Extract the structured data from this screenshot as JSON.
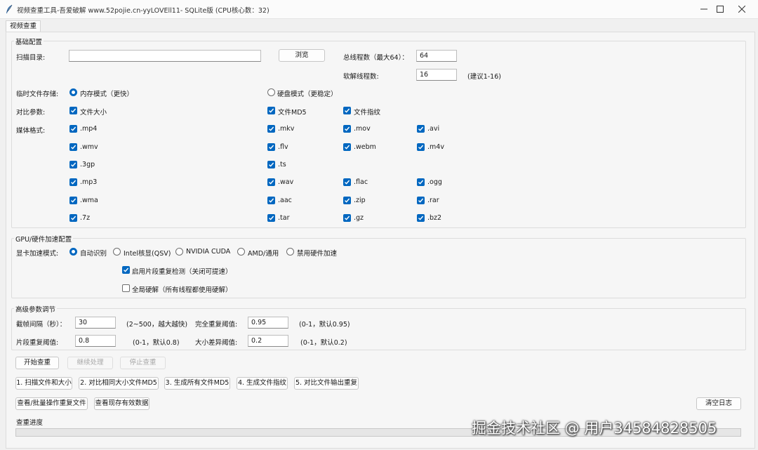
{
  "window": {
    "title": "视频查重工具-吾爱破解 www.52pojie.cn-yyLOVEll11- SQLite版 (CPU核心数：32)"
  },
  "tab": {
    "label": "视频查重"
  },
  "basic": {
    "group_title": "基础配置",
    "scan_dir_label": "扫描目录:",
    "scan_dir_value": "",
    "browse_label": "浏览",
    "total_threads_label": "总线程数（最大64）：",
    "total_threads_value": "64",
    "soft_threads_label": "软解线程数:",
    "soft_threads_value": "16",
    "soft_threads_hint": "(建议1-16)",
    "temp_storage_label": "临时文件存储:",
    "temp_mode_memory": "内存模式（更快）",
    "temp_mode_disk": "硬盘模式（更稳定）",
    "compare_label": "对比参数:",
    "compare_size": "文件大小",
    "compare_md5": "文件MD5",
    "compare_fingerprint": "文件指纹",
    "media_label": "媒体格式:",
    "formats": [
      ".mp4",
      ".mkv",
      ".mov",
      ".avi",
      ".wmv",
      ".flv",
      ".webm",
      ".m4v",
      ".3gp",
      ".ts",
      ".mp3",
      ".wav",
      ".flac",
      ".ogg",
      ".wma",
      ".aac",
      ".zip",
      ".rar",
      ".7z",
      ".tar",
      ".gz",
      ".bz2"
    ]
  },
  "gpu": {
    "group_title": "GPU/硬件加速配置",
    "mode_label": "显卡加速模式:",
    "modes": [
      "自动识别",
      "Intel核显(QSV)",
      "NVIDIA CUDA",
      "AMD/通用",
      "禁用硬件加速"
    ],
    "segment_check": "启用片段重复检测（关闭可提速）",
    "global_hw": "全局硬解（所有线程都使用硬解）"
  },
  "advanced": {
    "group_title": "高级参数调节",
    "frame_interval_label": "截帧间隔（秒）：",
    "frame_interval_value": "30",
    "frame_interval_hint": "(2~500，越大越快)",
    "full_dup_label": "完全重复阈值:",
    "full_dup_value": "0.95",
    "full_dup_hint": "(0-1，默认0.95)",
    "segment_dup_label": "片段重复阈值:",
    "segment_dup_value": "0.8",
    "segment_dup_hint": "(0-1，默认0.8)",
    "size_diff_label": "大小差异阈值:",
    "size_diff_value": "0.2",
    "size_diff_hint": "(0-1，默认0.2)"
  },
  "actions": {
    "start": "开始查重",
    "resume": "继续处理",
    "stop": "停止查重",
    "step1": "1. 扫描文件和大小",
    "step2": "2. 对比相同大小文件MD5",
    "step3": "3. 生成所有文件MD5",
    "step4": "4. 生成文件指纹",
    "step5": "5. 对比文件输出重复",
    "view_batch": "查看/批量操作重复文件",
    "view_valid": "查看现存有效数据",
    "clear_log": "清空日志"
  },
  "progress": {
    "label": "查重进度",
    "value": 0
  },
  "watermark": "掘金技术社区 @ 用户34584828505",
  "colors": {
    "accent": "#0067c0"
  }
}
